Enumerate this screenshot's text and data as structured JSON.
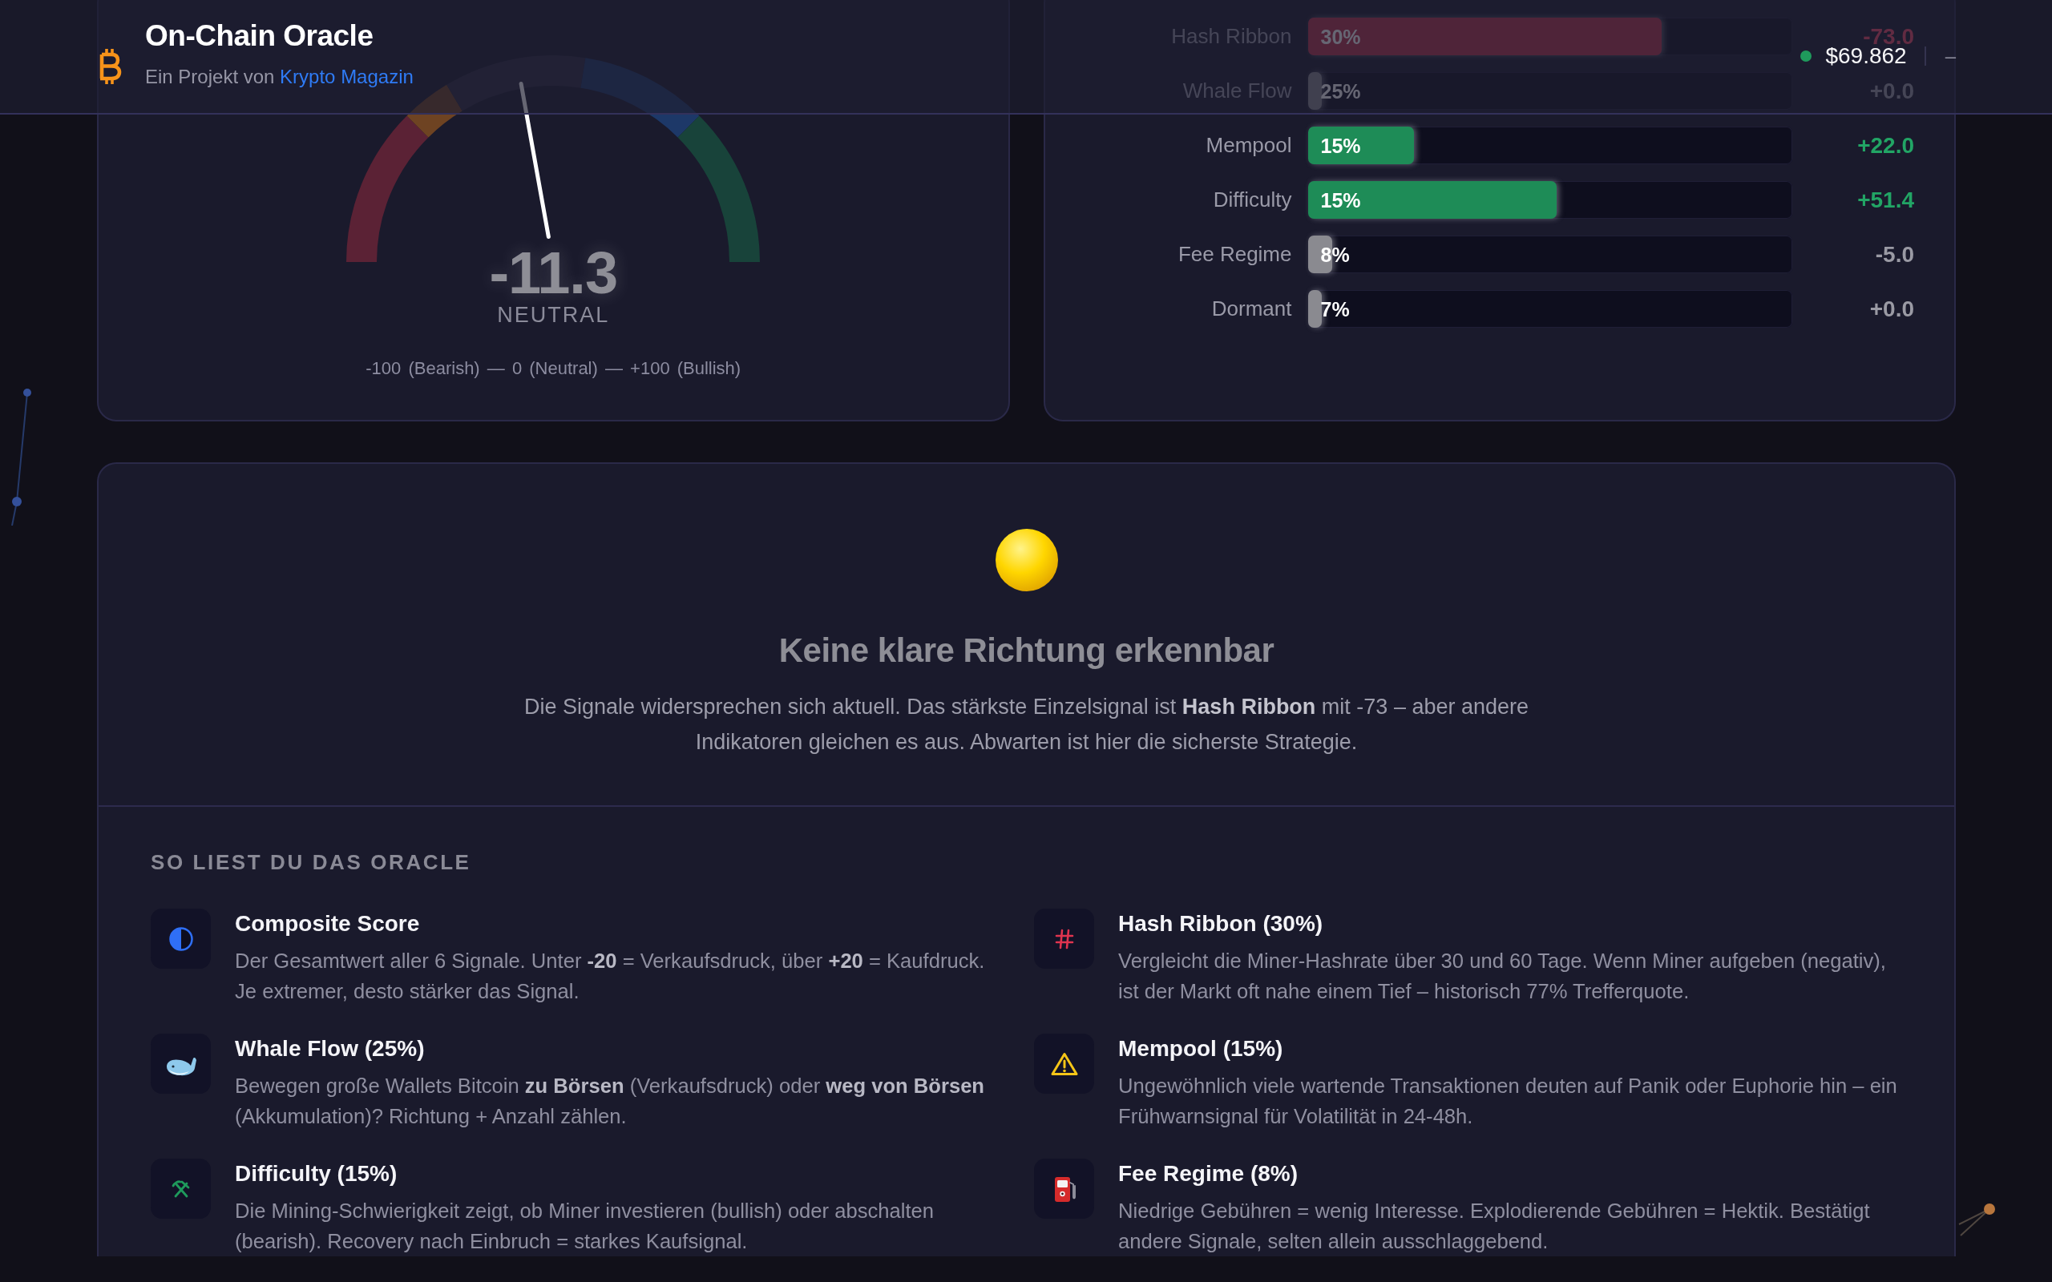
{
  "header": {
    "title": "On-Chain Oracle",
    "subtitle": "Ein Projekt von",
    "subtitle_link": "Krypto Magazin",
    "live": true,
    "price": "$69.862",
    "change": "–"
  },
  "gauge": {
    "level": 0.4435,
    "score": "-11.3",
    "label": "NEUTRAL",
    "scale": "-100 (Bearish) — 0 (Neutral) — +100 (Bullish)"
  },
  "signals": [
    {
      "name": "Hash Ribbon",
      "weight": "30%",
      "level": 0.73,
      "reading": "-73.0",
      "bullish": false,
      "bearish": true
    },
    {
      "name": "Whale Flow",
      "weight": "25%",
      "level": 0,
      "reading": "+0.0",
      "bullish": false,
      "bearish": false
    },
    {
      "name": "Mempool",
      "weight": "15%",
      "level": 0.22,
      "reading": "+22.0",
      "bullish": true,
      "bearish": false
    },
    {
      "name": "Difficulty",
      "weight": "15%",
      "level": 0.514,
      "reading": "+51.4",
      "bullish": true,
      "bearish": false
    },
    {
      "name": "Fee Regime",
      "weight": "8%",
      "level": 0.05,
      "reading": "-5.0",
      "bullish": false,
      "bearish": false
    },
    {
      "name": "Dormant",
      "weight": "7%",
      "level": 0,
      "reading": "+0.0",
      "bullish": false,
      "bearish": false
    }
  ],
  "verdict": {
    "title": "Keine klare Richtung erkennbar",
    "text": "Die Signale widersprechen sich aktuell. Das stärkste Einzelsignal ist **Hash Ribbon** mit -73 – aber andere Indikatoren gleichen es aus. Abwarten ist hier die sicherste Strategie."
  },
  "guide": {
    "heading": "SO LIEST DU DAS ORACLE",
    "items": [
      {
        "title": "Composite Score",
        "text": "Der Gesamtwert aller 6 Signale. Unter **-20** = Verkaufsdruck, über **+20** = Kaufdruck. Je extremer, desto stärker das Signal."
      },
      {
        "title": "Hash Ribbon (30%)",
        "text": "Vergleicht die Miner-Hashrate über 30 und 60 Tage. Wenn Miner aufgeben (negativ), ist der Markt oft nahe einem Tief – historisch 77% Trefferquote."
      },
      {
        "title": "Whale Flow (25%)",
        "text": "Bewegen große Wallets Bitcoin **zu Börsen** (Verkaufsdruck) oder **weg von Börsen** (Akkumulation)? Richtung + Anzahl zählen."
      },
      {
        "title": "Mempool (15%)",
        "text": "Ungewöhnlich viele wartende Transaktionen deuten auf Panik oder Euphorie hin – ein Frühwarnsignal für Volatilität in 24-48h."
      },
      {
        "title": "Difficulty (15%)",
        "text": "Die Mining-Schwierigkeit zeigt, ob Miner investieren (bullish) oder abschalten (bearish). Recovery nach Einbruch = starkes Kaufsignal."
      },
      {
        "title": "Fee Regime (8%)",
        "text": "Niedrige Gebühren = wenig Interesse. Explodierende Gebühren = Hektik. Bestätigt andere Signale, selten allein ausschlaggebend."
      }
    ]
  }
}
